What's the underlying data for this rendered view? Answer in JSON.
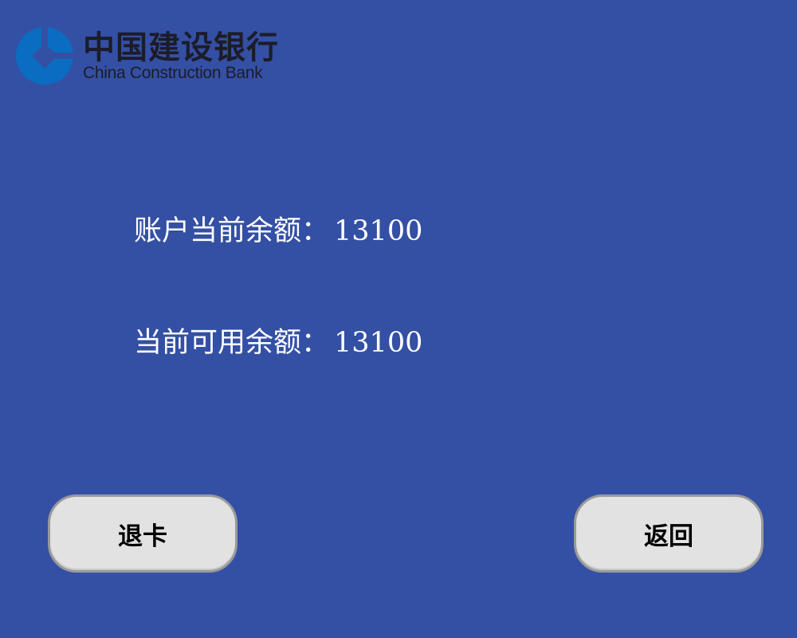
{
  "brand": {
    "name_cn": "中国建设银行",
    "name_en": "China Construction Bank",
    "logo_icon": "ccb-logo-icon",
    "logo_color": "#0A6DC2"
  },
  "balance": {
    "current_label": "账户当前余额：",
    "current_value": "13100",
    "available_label": "当前可用余额：",
    "available_value": "13100"
  },
  "buttons": {
    "eject_label": "退卡",
    "back_label": "返回"
  },
  "colors": {
    "background": "#3450A4",
    "button_bg": "#E2E2E2",
    "text_light": "#FFFFFF"
  }
}
